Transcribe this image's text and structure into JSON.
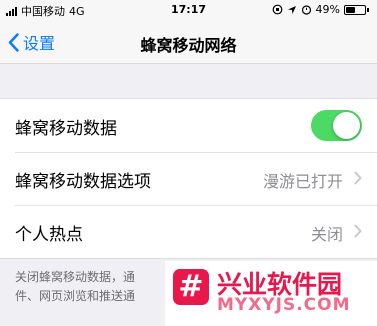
{
  "status_bar": {
    "carrier": "中国移动",
    "network": "4G",
    "time": "17:17",
    "battery_percent": "49%",
    "battery_level": 0.49
  },
  "nav": {
    "back_label": "设置",
    "title": "蜂窝移动网络"
  },
  "settings": {
    "cellular_data": {
      "label": "蜂窝移动数据",
      "enabled": true,
      "toggle_color": "#4cd964"
    },
    "cellular_options": {
      "label": "蜂窝移动数据选项",
      "value": "漫游已打开"
    },
    "hotspot": {
      "label": "个人热点",
      "value": "关闭"
    }
  },
  "footer": {
    "line1": "关闭蜂窝移动数据，通",
    "line2": "件、网页浏览和推送通"
  },
  "watermark": {
    "logo_glyph": "#",
    "title": "兴业软件园",
    "url": "MYXYJS.COM",
    "color": "#e8184c"
  }
}
